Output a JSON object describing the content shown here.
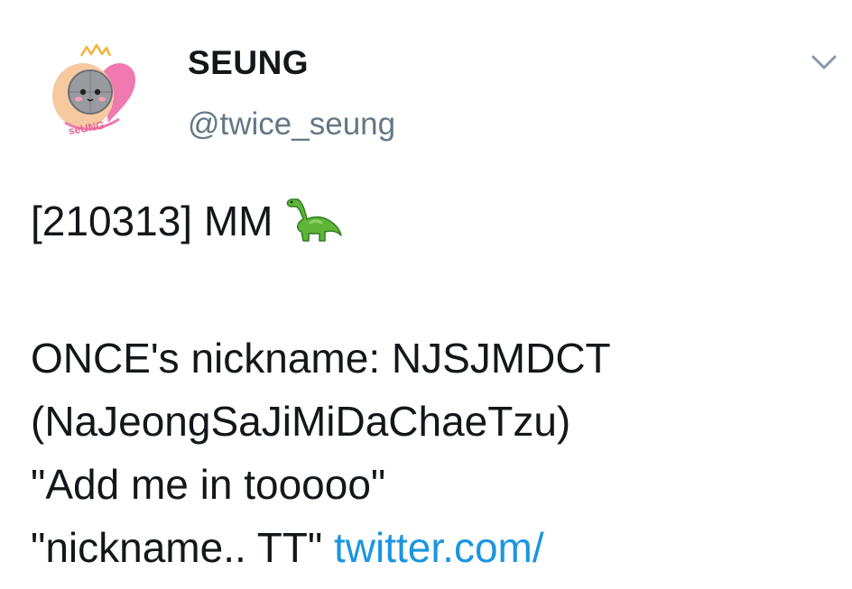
{
  "user": {
    "display_name": "SEUNG",
    "handle": "@twice_seung",
    "avatar_text": "seUNG",
    "avatar_icon": "avatar-logo"
  },
  "menu": {
    "icon": "chevron-down-icon"
  },
  "tweet": {
    "line1_text": "[210313] MM",
    "line1_emoji": "sauropod-emoji",
    "line2": "ONCE's nickname: NJSJMDCT",
    "line3": "(NaJeongSaJiMiDaChaeTzu)",
    "line4": "\"Add me in tooooo\"",
    "line5_text": "\"nickname.. TT\"",
    "link_text": "twitter.com/"
  },
  "colors": {
    "text": "#14171a",
    "handle": "#657786",
    "link": "#1b95e0",
    "avatar_pink": "#f07ab0",
    "avatar_peach": "#f6c9a0"
  }
}
